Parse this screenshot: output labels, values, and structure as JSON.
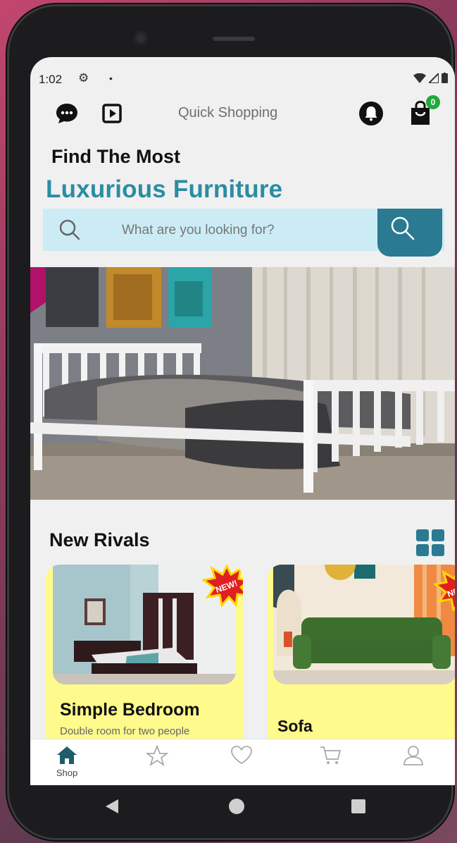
{
  "status": {
    "time": "1:02"
  },
  "header": {
    "title": "Quick Shopping",
    "cart_count": "0"
  },
  "hero": {
    "line1": "Find The Most",
    "line2": "Luxurious Furniture"
  },
  "search": {
    "placeholder": "What are you looking for?"
  },
  "section": {
    "title": "New Rivals"
  },
  "products": [
    {
      "title": "Simple Bedroom",
      "desc": "Double room for two people",
      "badge": "NEW!"
    },
    {
      "title": "Sofa",
      "desc": "",
      "badge": "NEW!"
    }
  ],
  "nav": {
    "shop_label": "Shop"
  },
  "colors": {
    "accent": "#2a8da3",
    "accent_dark": "#2a7a92",
    "card": "#fffa8c",
    "badge": "#1faa3a"
  }
}
